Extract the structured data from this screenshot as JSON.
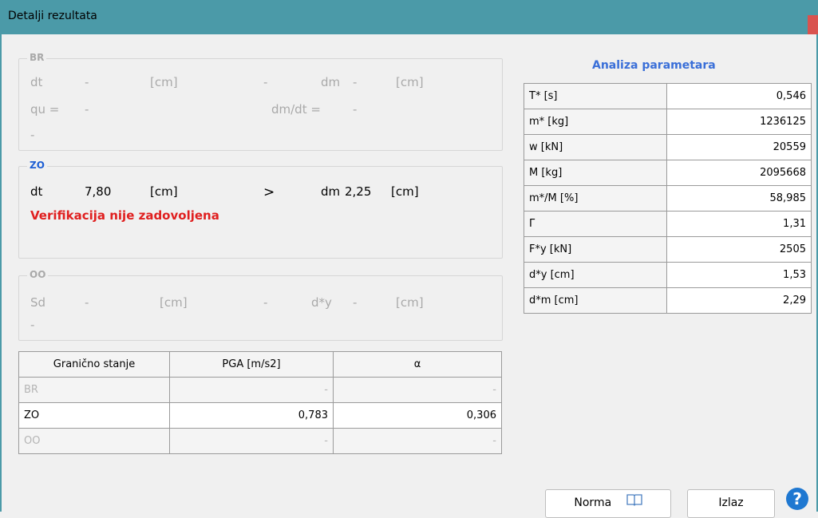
{
  "window": {
    "title": "Detalji rezultata"
  },
  "br": {
    "legend": "BR",
    "dt_label": "dt",
    "dt_val": "-",
    "dt_unit": "[cm]",
    "cmp": "-",
    "dm_label": "dm",
    "dm_val": "-",
    "dm_unit": "[cm]",
    "qu_label": "qu =",
    "qu_val": "-",
    "ratio_label": "dm/dt =",
    "ratio_val": "-",
    "status": "-"
  },
  "zo": {
    "legend": "ZO",
    "dt_label": "dt",
    "dt_val": "7,80",
    "dt_unit": "[cm]",
    "cmp": ">",
    "dm_label": "dm",
    "dm_val": "2,25",
    "dm_unit": "[cm]",
    "status": "Verifikacija nije zadovoljena"
  },
  "oo": {
    "legend": "OO",
    "sd_label": "Sd",
    "sd_val": "-",
    "sd_unit": "[cm]",
    "cmp": "-",
    "dy_label": "d*y",
    "dy_val": "-",
    "dy_unit": "[cm]",
    "status": "-"
  },
  "results_table": {
    "headers": [
      "Granično stanje",
      "PGA [m/s2]",
      "α"
    ],
    "rows": [
      {
        "state": "BR",
        "pga": "-",
        "alpha": "-"
      },
      {
        "state": "ZO",
        "pga": "0,783",
        "alpha": "0,306"
      },
      {
        "state": "OO",
        "pga": "-",
        "alpha": "-"
      }
    ]
  },
  "params": {
    "title": "Analiza parametara",
    "rows": [
      {
        "label": "T* [s]",
        "value": "0,546"
      },
      {
        "label": "m* [kg]",
        "value": "1236125"
      },
      {
        "label": "w [kN]",
        "value": "20559"
      },
      {
        "label": "M [kg]",
        "value": "2095668"
      },
      {
        "label": "m*/M [%]",
        "value": "58,985"
      },
      {
        "label": "Γ",
        "value": "1,31"
      },
      {
        "label": "F*y [kN]",
        "value": "2505"
      },
      {
        "label": "d*y [cm]",
        "value": "1,53"
      },
      {
        "label": "d*m [cm]",
        "value": "2,29"
      }
    ]
  },
  "buttons": {
    "norma": "Norma",
    "izlaz": "Izlaz",
    "help": "?"
  },
  "icons": {
    "norma": "book-icon",
    "help": "help-icon"
  }
}
